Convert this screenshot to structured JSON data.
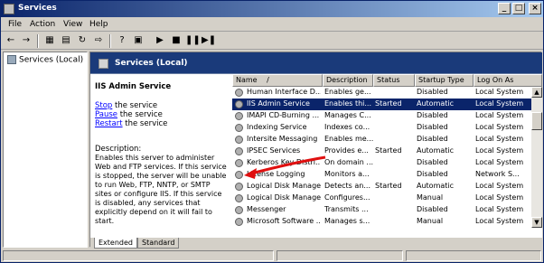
{
  "window": {
    "title": "Services"
  },
  "menu": [
    "File",
    "Action",
    "View",
    "Help"
  ],
  "toolbar": {
    "icons": [
      "back-icon",
      "forward-icon",
      "show-hide-tree-icon",
      "properties-icon",
      "refresh-icon",
      "export-icon",
      "help-icon",
      "help-topics-icon",
      "start-icon",
      "stop-icon",
      "pause-icon",
      "restart-icon"
    ],
    "glyphs": [
      "←",
      "→",
      "▦",
      "▤",
      "↻",
      "⇨",
      "?",
      "▣",
      "▶",
      "■",
      "❚❚",
      "▶❚"
    ]
  },
  "tree": {
    "item": "Services (Local)"
  },
  "pane_header": {
    "title": "Services (Local)"
  },
  "detail": {
    "service_name": "IIS Admin Service",
    "actions": [
      {
        "link": "Stop",
        "rest": " the service"
      },
      {
        "link": "Pause",
        "rest": " the service"
      },
      {
        "link": "Restart",
        "rest": " the service"
      }
    ],
    "description_label": "Description:",
    "description": "Enables this server to administer Web and FTP services. If this service is stopped, the server will be unable to run Web, FTP, NNTP, or SMTP sites or configure IIS. If this service is disabled, any services that explicitly depend on it will fail to start."
  },
  "list": {
    "columns": [
      "Name",
      "Description",
      "Status",
      "Startup Type",
      "Log On As"
    ],
    "sort_indicator": "/",
    "rows": [
      [
        "Human Interface D...",
        "Enables ge...",
        "",
        "Disabled",
        "Local System"
      ],
      [
        "IIS Admin Service",
        "Enables thi...",
        "Started",
        "Automatic",
        "Local System"
      ],
      [
        "IMAPI CD-Burning ...",
        "Manages C...",
        "",
        "Disabled",
        "Local System"
      ],
      [
        "Indexing Service",
        "Indexes co...",
        "",
        "Disabled",
        "Local System"
      ],
      [
        "Intersite Messaging",
        "Enables me...",
        "",
        "Disabled",
        "Local System"
      ],
      [
        "IPSEC Services",
        "Provides e...",
        "Started",
        "Automatic",
        "Local System"
      ],
      [
        "Kerberos Key Distri...",
        "On domain ...",
        "",
        "Disabled",
        "Local System"
      ],
      [
        "License Logging",
        "Monitors a...",
        "",
        "Disabled",
        "Network S..."
      ],
      [
        "Logical Disk Manager",
        "Detects an...",
        "Started",
        "Automatic",
        "Local System"
      ],
      [
        "Logical Disk Manage...",
        "Configures...",
        "",
        "Manual",
        "Local System"
      ],
      [
        "Messenger",
        "Transmits ...",
        "",
        "Disabled",
        "Local System"
      ],
      [
        "Microsoft Software ...",
        "Manages s...",
        "",
        "Manual",
        "Local System"
      ],
      [
        "Net Logon",
        "Maintains a...",
        "",
        "Manual",
        "Local System"
      ]
    ],
    "selected_index": 1
  },
  "tabs": [
    "Extended",
    "Standard"
  ],
  "colors": {
    "title_start": "#0a246a",
    "title_end": "#a6caf0",
    "header_band": "#1a3a7a",
    "selection": "#0a246a",
    "link": "#0000ff",
    "annotation_arrow": "#e01010"
  }
}
